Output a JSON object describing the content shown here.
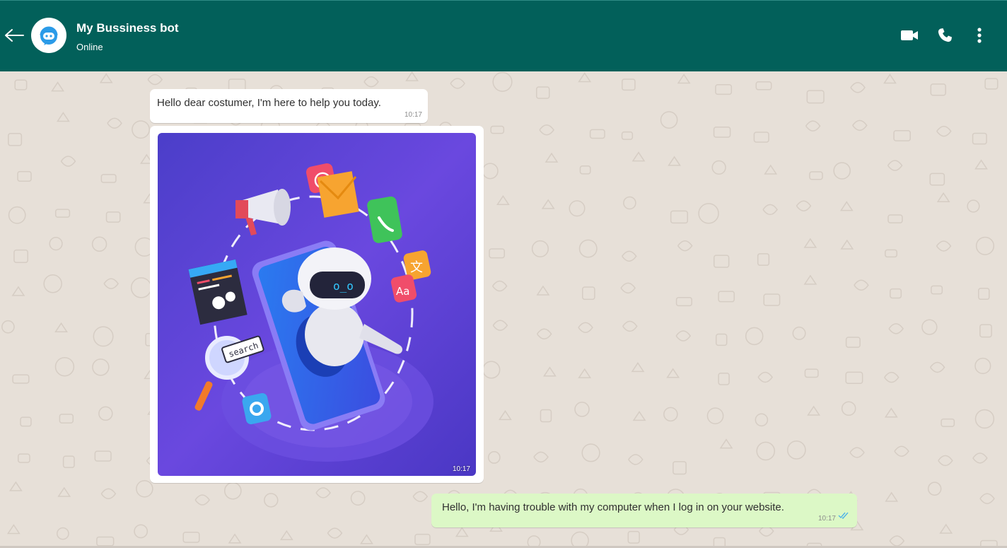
{
  "header": {
    "contact_name": "My Bussiness bot",
    "status": "Online",
    "icons": [
      "back-arrow-icon",
      "bot-avatar",
      "video-call-icon",
      "phone-icon",
      "more-options-icon"
    ]
  },
  "messages": [
    {
      "direction": "incoming",
      "type": "text",
      "text": "Hello dear costumer, I'm here to help you today.",
      "time": "10:17"
    },
    {
      "direction": "incoming",
      "type": "image",
      "image_alt": "robot-in-phone-illustration",
      "time": "10:17",
      "image_label": "search"
    },
    {
      "direction": "outgoing",
      "type": "text",
      "text": "Hello, I'm having trouble with my computer when I log in on your website.",
      "time": "10:17",
      "receipt": "double-check-icon"
    }
  ],
  "colors": {
    "header_bg": "#02605a",
    "chat_bg": "#e7e0d8",
    "incoming_bubble": "#ffffff",
    "outgoing_bubble": "#dcf8c6",
    "read_receipt": "#4fb3e8",
    "illustration_bg": "#5b3fd6"
  }
}
